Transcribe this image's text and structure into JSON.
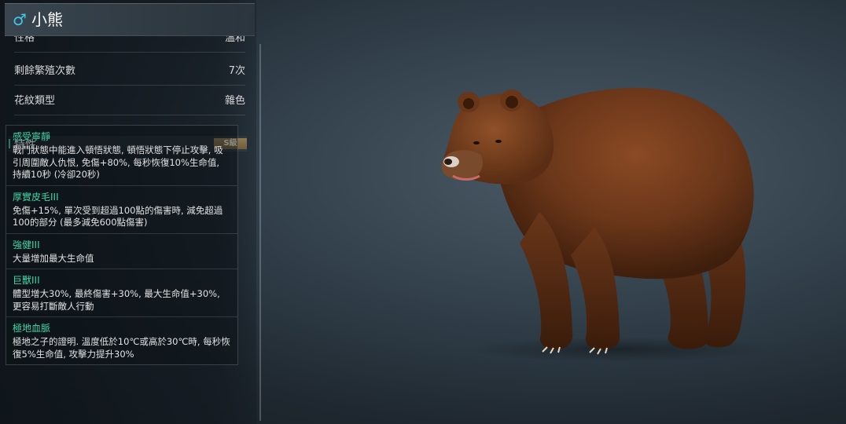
{
  "header": {
    "gender_icon": "male-icon",
    "gender_symbol": "♂",
    "name": "小熊"
  },
  "info_rows": [
    {
      "label": "性格",
      "value": "溫和"
    },
    {
      "label": "剩餘繁殖次數",
      "value": "7次"
    },
    {
      "label": "花紋類型",
      "value": "雜色"
    }
  ],
  "traits": {
    "title": "特性",
    "grade": "S級",
    "items": [
      {
        "name": "感受寧靜",
        "desc": "戰鬥狀態中能進入頓悟狀態, 頓悟狀態下停止攻擊, 吸引周圍敵人仇恨, 免傷+80%, 每秒恢復10%生命值, 持續10秒 (冷卻20秒)"
      },
      {
        "name": "厚實皮毛III",
        "desc": "免傷+15%, 單次受到超過100點的傷害時, 減免超過100的部分 (最多減免600點傷害)"
      },
      {
        "name": "強健III",
        "desc": "大量增加最大生命值"
      },
      {
        "name": "巨獸III",
        "desc": "體型增大30%, 最終傷害+30%, 最大生命值+30%, 更容易打斷敵人行動"
      },
      {
        "name": "極地血脈",
        "desc": "極地之子的證明. 溫度低於10℃或高於30℃時, 每秒恢復5%生命值, 攻擊力提升30%"
      }
    ]
  },
  "colors": {
    "accent_teal": "#3fd6a8",
    "gender_blue": "#3ec8e6",
    "grade_badge": "#8f7a54"
  }
}
